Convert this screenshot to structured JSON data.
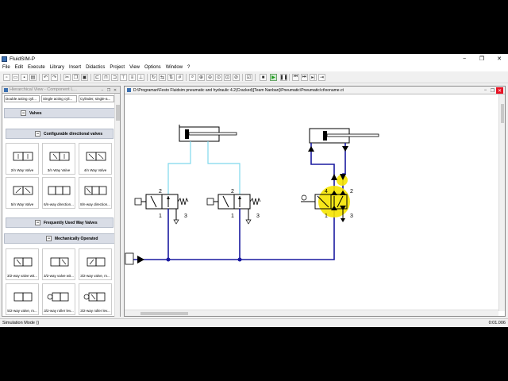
{
  "window": {
    "title": "FluidSIM-P",
    "minimize": "−",
    "restore": "❐",
    "close": "✕"
  },
  "menu": [
    "File",
    "Edit",
    "Execute",
    "Library",
    "Insert",
    "Didactics",
    "Project",
    "View",
    "Options",
    "Window",
    "?"
  ],
  "library": {
    "title": "Hierarchical View - Component L...",
    "top_cells": [
      "Double acting cyli...",
      "Single acting cyli...",
      "Cylinder, single-a..."
    ],
    "groups": {
      "valves": "Valves",
      "configurable": "Configurable directional valves",
      "frequently": "Frequently Used Way Valves",
      "mechanical": "Mechanically Operated"
    },
    "configurable_items": [
      "2/n Way Valve",
      "3/n Way Valve",
      "4/n Way Valve",
      "5/n Way Valve",
      "6/n-way direction...",
      "8/n-way direction..."
    ],
    "mechanical_items": [
      "3/2-way valve wit...",
      "3/2-way valve wit...",
      "3/2-way valve, m...",
      "5/2-way valve, m...",
      "3/2-way roller lev...",
      "3/2-way roller lev..."
    ]
  },
  "canvas": {
    "path": "D:\\Programari\\Festo Fluidsim pneumatic and hydraulic 4.2(Cracked)[Team Nanban]\\Pneumatic\\Pneumatic\\ct\\noname.ct",
    "ports": {
      "v1_2": "2",
      "v1_1": "1",
      "v1_3": "3",
      "v2_2": "2",
      "v2_1": "1",
      "v2_3": "3",
      "v3_4": "4",
      "v3_2": "2",
      "v3_1": "1",
      "v3_3": "3"
    }
  },
  "colors": {
    "pressure_line": "#1a1aa0",
    "exhaust_line": "#7fd8ec",
    "highlight": "#f5e400",
    "flow_arrow": "#000000"
  },
  "status": {
    "mode": "Simulation Mode ()",
    "time": "0:01.006"
  }
}
